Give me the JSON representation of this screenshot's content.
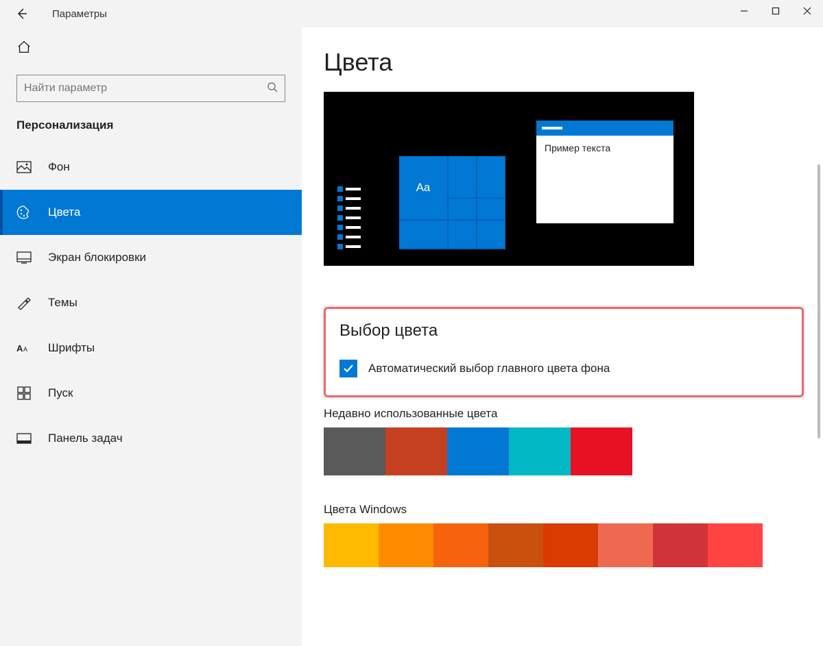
{
  "titlebar": {
    "app_title": "Параметры"
  },
  "sidebar": {
    "search_placeholder": "Найти параметр",
    "category": "Персонализация",
    "items": [
      {
        "label": "Фон",
        "icon": "image-icon",
        "active": false
      },
      {
        "label": "Цвета",
        "icon": "palette-icon",
        "active": true
      },
      {
        "label": "Экран блокировки",
        "icon": "lock-screen-icon",
        "active": false
      },
      {
        "label": "Темы",
        "icon": "themes-icon",
        "active": false
      },
      {
        "label": "Шрифты",
        "icon": "fonts-icon",
        "active": false
      },
      {
        "label": "Пуск",
        "icon": "start-icon",
        "active": false
      },
      {
        "label": "Панель задач",
        "icon": "taskbar-icon",
        "active": false
      }
    ]
  },
  "content": {
    "page_title": "Цвета",
    "preview": {
      "sample_text": "Пример текста",
      "tile_text": "Aa"
    },
    "section_choose_color": "Выбор цвета",
    "checkbox_auto_label": "Автоматический выбор главного цвета фона",
    "recent_colors_title": "Недавно использованные цвета",
    "recent_colors": [
      "#5a5a5a",
      "#c54021",
      "#0078d4",
      "#00b7c3",
      "#e81123"
    ],
    "windows_colors_title": "Цвета Windows",
    "windows_colors": [
      "#ffb900",
      "#ff8c00",
      "#f7630c",
      "#ca5010",
      "#da3b01",
      "#ef6950",
      "#d13438",
      "#ff4343"
    ]
  }
}
